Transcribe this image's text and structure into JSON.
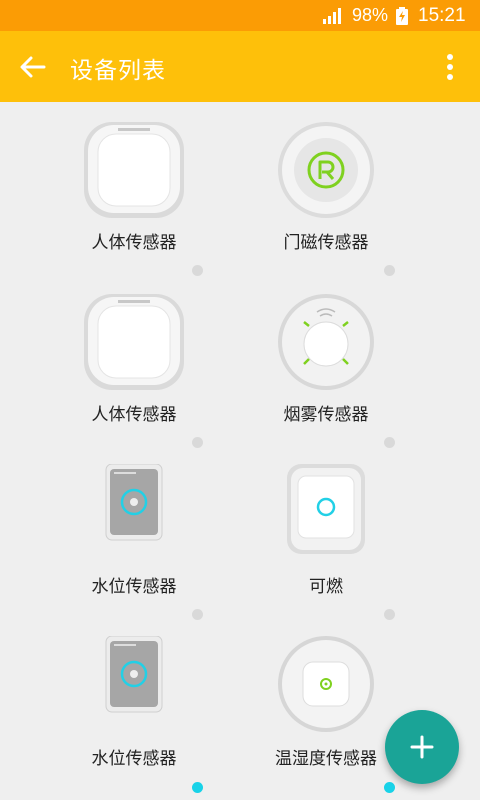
{
  "status_bar": {
    "battery_percent": "98%",
    "time": "15:21"
  },
  "app_bar": {
    "title": "设备列表",
    "back_icon": "arrow-back-icon",
    "menu_icon": "more-vert-icon"
  },
  "devices": [
    {
      "label": "人体传感器",
      "icon": "motion-sensor-icon"
    },
    {
      "label": "门磁传感器",
      "icon": "door-sensor-icon"
    },
    {
      "label": "人体传感器",
      "icon": "motion-sensor-icon"
    },
    {
      "label": "烟雾传感器",
      "icon": "smoke-sensor-icon"
    },
    {
      "label": "水位传感器",
      "icon": "water-sensor-icon"
    },
    {
      "label": "可燃",
      "icon": "gas-sensor-icon"
    },
    {
      "label": "水位传感器",
      "icon": "water-sensor-icon"
    },
    {
      "label": "温湿度传感器",
      "icon": "temp-humidity-sensor-icon"
    }
  ],
  "fab": {
    "icon": "add-icon"
  },
  "colors": {
    "status_bar": "#fb9c05",
    "app_bar": "#fec00a",
    "fab": "#1aa497",
    "dot_active": "#18d2e8",
    "dot_inactive": "#d9d9d9",
    "door_logo": "#7fd11f"
  }
}
